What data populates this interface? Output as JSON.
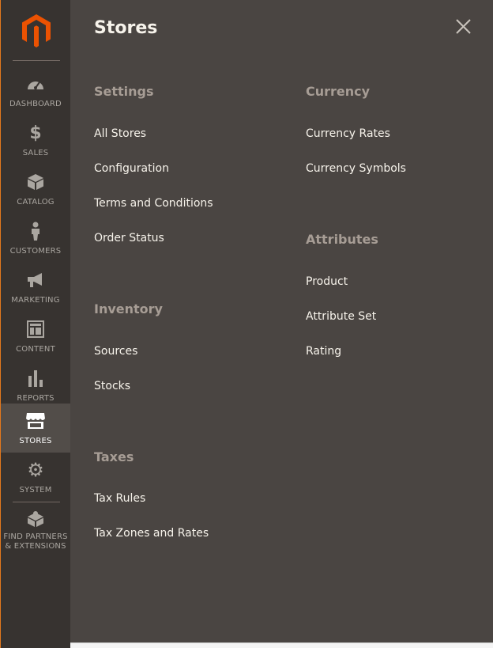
{
  "sidebar": {
    "logo": {
      "icon": "magento-logo-icon",
      "color": "#eb5202"
    },
    "items": [
      {
        "label": "DASHBOARD",
        "icon": "dashboard-gauge-icon"
      },
      {
        "label": "SALES",
        "icon": "dollar-icon"
      },
      {
        "label": "CATALOG",
        "icon": "box-icon"
      },
      {
        "label": "CUSTOMERS",
        "icon": "person-icon"
      },
      {
        "label": "MARKETING",
        "icon": "megaphone-icon"
      },
      {
        "label": "CONTENT",
        "icon": "layout-icon"
      },
      {
        "label": "REPORTS",
        "icon": "bar-chart-icon"
      },
      {
        "label": "STORES",
        "icon": "storefront-icon",
        "active": true
      },
      {
        "label": "SYSTEM",
        "icon": "gear-icon"
      },
      {
        "label_line1": "FIND PARTNERS",
        "label_line2": "& EXTENSIONS",
        "icon": "puzzle-cube-icon"
      }
    ],
    "colors": {
      "background": "#373330",
      "active_background": "#524d49",
      "accent_border": "#e3781c"
    }
  },
  "panel": {
    "title": "Stores",
    "close_icon": "close-icon",
    "sections": {
      "settings": {
        "title": "Settings",
        "links": [
          "All Stores",
          "Configuration",
          "Terms and Conditions",
          "Order Status"
        ]
      },
      "inventory": {
        "title": "Inventory",
        "links": [
          "Sources",
          "Stocks"
        ]
      },
      "taxes": {
        "title": "Taxes",
        "links": [
          "Tax Rules",
          "Tax Zones and Rates"
        ]
      },
      "currency": {
        "title": "Currency",
        "links": [
          "Currency Rates",
          "Currency Symbols"
        ]
      },
      "attributes": {
        "title": "Attributes",
        "links": [
          "Product",
          "Attribute Set",
          "Rating"
        ]
      }
    },
    "colors": {
      "background": "#4a4542",
      "section_title": "#a79d95",
      "link": "#f7f3eb"
    }
  }
}
